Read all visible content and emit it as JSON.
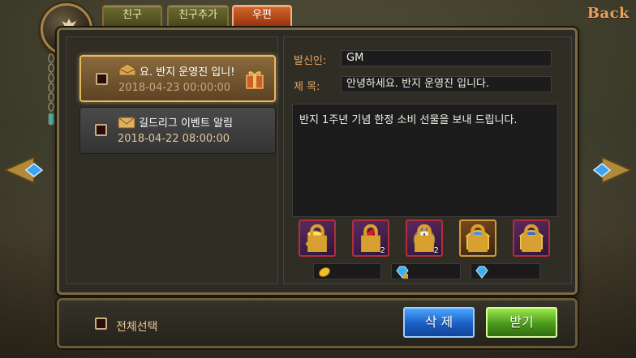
{
  "header": {
    "medallion_label": "친구",
    "back_label": "Back",
    "tabs": [
      {
        "label": "친구",
        "active": false
      },
      {
        "label": "친구추가",
        "active": false
      },
      {
        "label": "우편",
        "active": true
      }
    ]
  },
  "mail_list": [
    {
      "title": "요. 반지 운영진 입니!",
      "date": "2018-04-23 00:00:00",
      "selected": true,
      "has_gift": true,
      "icon": "open-envelope-icon"
    },
    {
      "title": "길드리그 이벤트 알림",
      "date": "2018-04-22 08:00:00",
      "selected": false,
      "has_gift": false,
      "icon": "envelope-icon"
    }
  ],
  "detail": {
    "sender_label": "발신인:",
    "sender_value": "GM",
    "subject_label": "제  목:",
    "subject_value": "안녕하세요. 반지 운영진 입니다.",
    "body": "반지 1주년 기념 한정 소비 선물을 보내 드립니다.",
    "attachments": [
      {
        "icon": "gold-coins-icon",
        "count": ""
      },
      {
        "icon": "red-horn-icon",
        "count": "2"
      },
      {
        "icon": "pocket-watch-icon",
        "count": "2"
      },
      {
        "icon": "gold-chest-icon",
        "count": ""
      },
      {
        "icon": "blue-gold-chest-icon",
        "count": ""
      }
    ],
    "currencies": [
      {
        "icon": "gold-coin-icon",
        "value": ""
      },
      {
        "icon": "locked-diamond-icon",
        "value": ""
      },
      {
        "icon": "diamond-icon",
        "value": ""
      }
    ]
  },
  "footer": {
    "select_all_label": "전체선택",
    "delete_label": "삭 제",
    "receive_label": "받기"
  },
  "colors": {
    "accent_orange": "#e2a560",
    "selected_mail_border": "#e8b860",
    "delete_blue": "#1b5fc4",
    "receive_green": "#4c9a1c"
  }
}
